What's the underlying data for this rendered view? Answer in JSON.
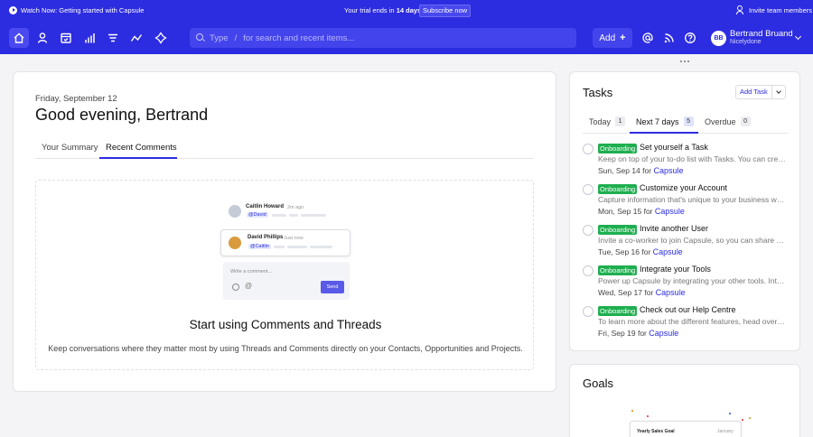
{
  "announcement": {
    "watch_label": "Watch Now: Getting started with Capsule",
    "trial_prefix": "Your trial ends in",
    "trial_days": "14 days",
    "subscribe_label": "Subscribe now",
    "invite_label": "Invite team members"
  },
  "nav": {
    "icons": [
      "home-icon",
      "person-icon",
      "calendar-icon",
      "bar-chart-icon",
      "list-icon",
      "trend-icon",
      "lightning-icon"
    ],
    "search": {
      "type_hint": "Type",
      "slash": "/",
      "placeholder": "for search and recent items..."
    },
    "add_label": "Add",
    "user": {
      "initials": "BB",
      "name": "Bertrand Bruand",
      "org": "Nicelydone"
    },
    "colors": {
      "brand": "#2c2ce0"
    }
  },
  "main": {
    "date": "Friday, September 12",
    "greeting": "Good evening, Bertrand",
    "tabs": [
      {
        "label": "Your Summary",
        "active": false
      },
      {
        "label": "Recent Comments",
        "active": true
      }
    ],
    "illustration": {
      "comment1": {
        "name": "Caitlin Howard",
        "time": "2m ago",
        "mention": "@David"
      },
      "comment2": {
        "name": "David Phillips",
        "time": "Just now",
        "mention": "@Caitlin"
      },
      "composer_placeholder": "Write a comment...",
      "send_label": "Send"
    },
    "empty_title": "Start using Comments and Threads",
    "empty_desc": "Keep conversations where they matter most by using Threads and Comments directly on your Contacts, Opportunities and Projects."
  },
  "tasks": {
    "title": "Tasks",
    "add_label": "Add Task",
    "tabs": [
      {
        "label": "Today",
        "count": "1",
        "active": false
      },
      {
        "label": "Next 7 days",
        "count": "5",
        "active": true
      },
      {
        "label": "Overdue",
        "count": "0",
        "active": false
      }
    ],
    "items": [
      {
        "badge": "Onboarding",
        "title": "Set yourself a Task",
        "desc": "Keep on top of your to-do list with Tasks. You can create tasks for yourself or your team.",
        "date": "Sun, Sep 14",
        "for": "for",
        "link": "Capsule"
      },
      {
        "badge": "Onboarding",
        "title": "Customize your Account",
        "desc": "Capture information that's unique to your business with custom fields.",
        "date": "Mon, Sep 15",
        "for": "for",
        "link": "Capsule"
      },
      {
        "badge": "Onboarding",
        "title": "Invite another User",
        "desc": "Invite a co-worker to join Capsule, so you can share contacts and tasks.",
        "date": "Tue, Sep 16",
        "for": "for",
        "link": "Capsule"
      },
      {
        "badge": "Onboarding",
        "title": "Integrate your Tools",
        "desc": "Power up Capsule by integrating your other tools. Integrations connect your apps.",
        "date": "Wed, Sep 17",
        "for": "for",
        "link": "Capsule"
      },
      {
        "badge": "Onboarding",
        "title": "Check out our Help Centre",
        "desc": "To learn more about the different features, head over to our Help Centre.",
        "date": "Fri, Sep 19",
        "for": "for",
        "link": "Capsule"
      }
    ],
    "colors": {
      "badge": "#1fae4f"
    }
  },
  "goals": {
    "title": "Goals",
    "illustration": {
      "label": "Yearly Sales Goal",
      "month": "January"
    }
  }
}
